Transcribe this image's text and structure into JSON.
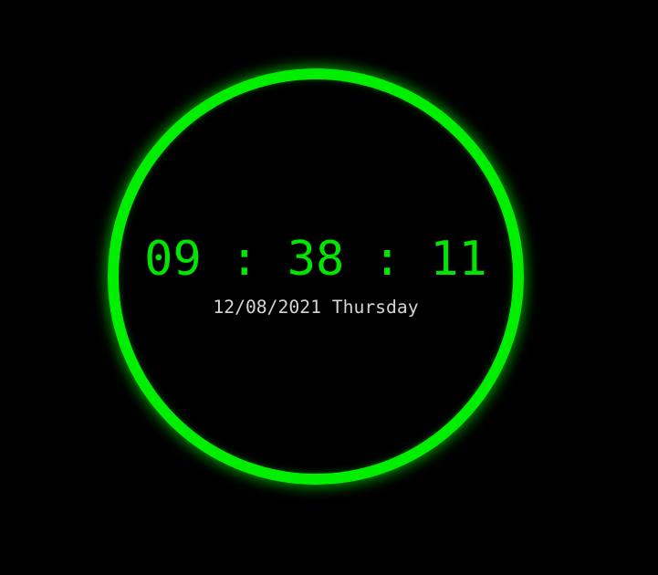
{
  "clock": {
    "time": "09 : 38 : 11",
    "date": "12/08/2021 Thursday"
  },
  "colors": {
    "accent": "#00ee00",
    "background": "#000000",
    "date_text": "#d4d4d4"
  }
}
